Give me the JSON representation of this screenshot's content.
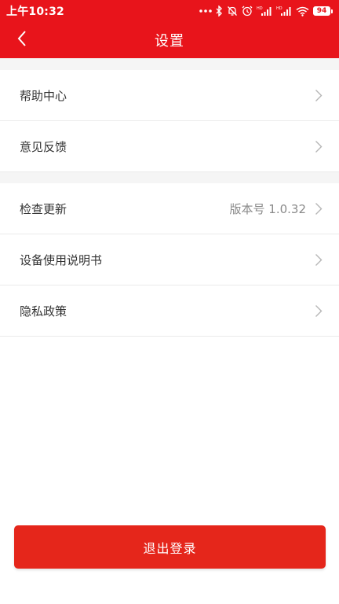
{
  "status_bar": {
    "time": "上午10:32",
    "battery": "94",
    "icons": [
      "more-dots-icon",
      "bluetooth-icon",
      "mute-bell-icon",
      "alarm-icon",
      "signal-hd-icon",
      "signal-hd-icon",
      "wifi-icon",
      "battery-icon"
    ],
    "hd_label": "HD"
  },
  "header": {
    "title": "设置",
    "back_icon": "chevron-left-icon"
  },
  "groups": [
    {
      "items": [
        {
          "label": "帮助中心",
          "value": ""
        },
        {
          "label": "意见反馈",
          "value": ""
        }
      ]
    },
    {
      "items": [
        {
          "label": "检查更新",
          "value": "版本号 1.0.32"
        },
        {
          "label": "设备使用说明书",
          "value": ""
        },
        {
          "label": "隐私政策",
          "value": ""
        }
      ]
    }
  ],
  "logout": {
    "label": "退出登录"
  },
  "colors": {
    "brand": "#e8141b",
    "button": "#e5261b",
    "divider": "#ebebeb",
    "background_gap": "#f5f5f5",
    "text_primary": "#333333",
    "text_secondary": "#8a8a8a"
  }
}
